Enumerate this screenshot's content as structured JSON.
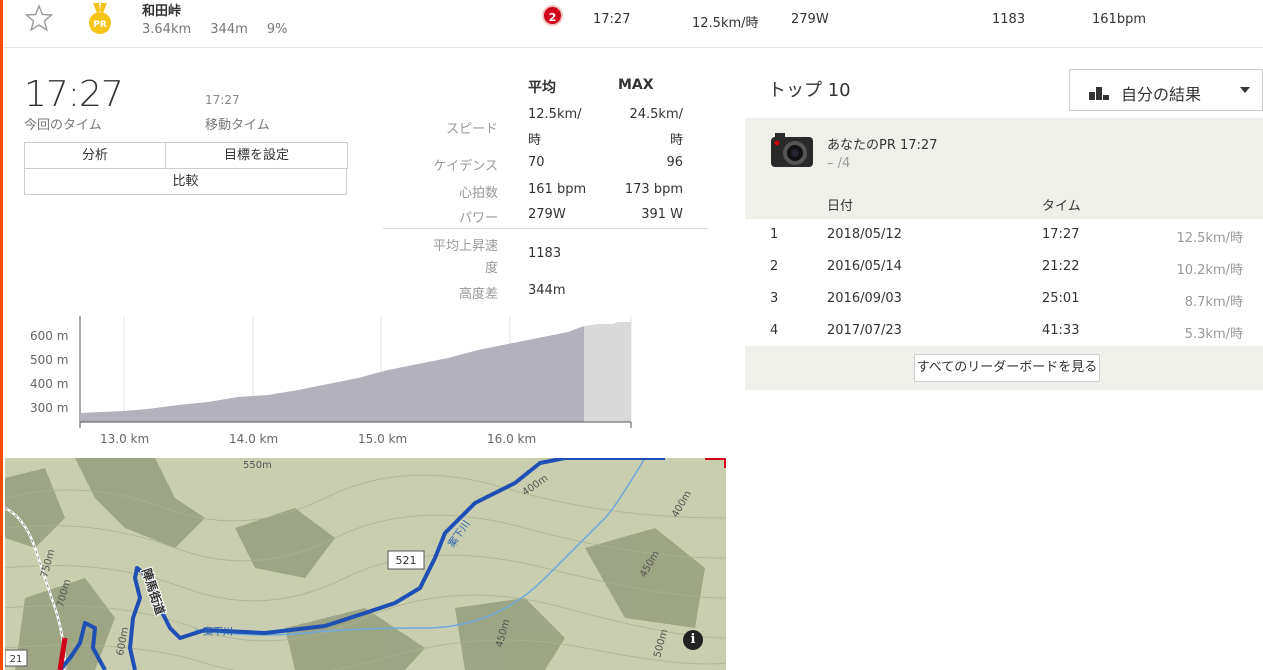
{
  "segment_row": {
    "name": "和田峠",
    "distance": "3.64km",
    "elevation": "344m",
    "grade": "9%",
    "pr_badge": "PR",
    "rank": "2",
    "time": "17:27",
    "speed": "12.5km/時",
    "power": "279W",
    "vam": "1183",
    "heart_rate": "161bpm"
  },
  "summary": {
    "time": "17:27",
    "time_label": "今回のタイム",
    "moving_time": "17:27",
    "moving_label": "移動タイム"
  },
  "buttons": {
    "analyze": "分析",
    "set_goal": "目標を設定",
    "compare": "比較"
  },
  "stats": {
    "col_avg": "平均",
    "col_max": "MAX",
    "speed_label": "スピード",
    "speed_avg": "12.5km/",
    "speed_avg_unit": "時",
    "speed_max": "24.5km/",
    "speed_max_unit": "時",
    "cadence_label": "ケイデンス",
    "cadence_avg": "70",
    "cadence_max": "96",
    "hr_label": "心拍数",
    "hr_avg": "161 bpm",
    "hr_max": "173 bpm",
    "power_label": "パワー",
    "power_avg": "279W",
    "power_max": "391 W",
    "vam_label_1": "平均上昇速",
    "vam_label_2": "度",
    "vam_avg": "1183",
    "elev_label": "高度差",
    "elev_avg": "344m"
  },
  "elevation_chart": {
    "y_ticks": [
      "600 m",
      "500 m",
      "400 m",
      "300 m"
    ],
    "x_ticks": [
      "13.0 km",
      "14.0 km",
      "15.0 km",
      "16.0 km"
    ]
  },
  "map": {
    "labels": {
      "contour_550": "550m",
      "contour_400a": "400m",
      "contour_400b": "400m",
      "contour_450a": "450m",
      "contour_450b": "450m",
      "contour_500": "500m",
      "contour_600": "600m",
      "contour_750": "750m",
      "contour_700": "700m",
      "route_number": "521",
      "road_name": "陣馬街道",
      "river_name": "案下川",
      "river_name2": "案下川",
      "corner_21": "21"
    },
    "info": "i"
  },
  "leaderboard": {
    "title": "トップ 10",
    "filter": "自分の結果",
    "my_pr": "あなたのPR 17:27",
    "my_rank": "– /4",
    "col_date": "日付",
    "col_time": "タイム",
    "rows": [
      {
        "rank": "1",
        "date": "2018/05/12",
        "time": "17:27",
        "speed": "12.5km/時"
      },
      {
        "rank": "2",
        "date": "2016/05/14",
        "time": "21:22",
        "speed": "10.2km/時"
      },
      {
        "rank": "3",
        "date": "2016/09/03",
        "time": "25:01",
        "speed": "8.7km/時"
      },
      {
        "rank": "4",
        "date": "2017/07/23",
        "time": "41:33",
        "speed": "5.3km/時"
      }
    ],
    "view_all": "すべてのリーダーボードを見る"
  },
  "colors": {
    "accent": "#fc4c02",
    "route": "#1f4fb5",
    "badge": "#d0021b",
    "medal": "#f5c518"
  }
}
